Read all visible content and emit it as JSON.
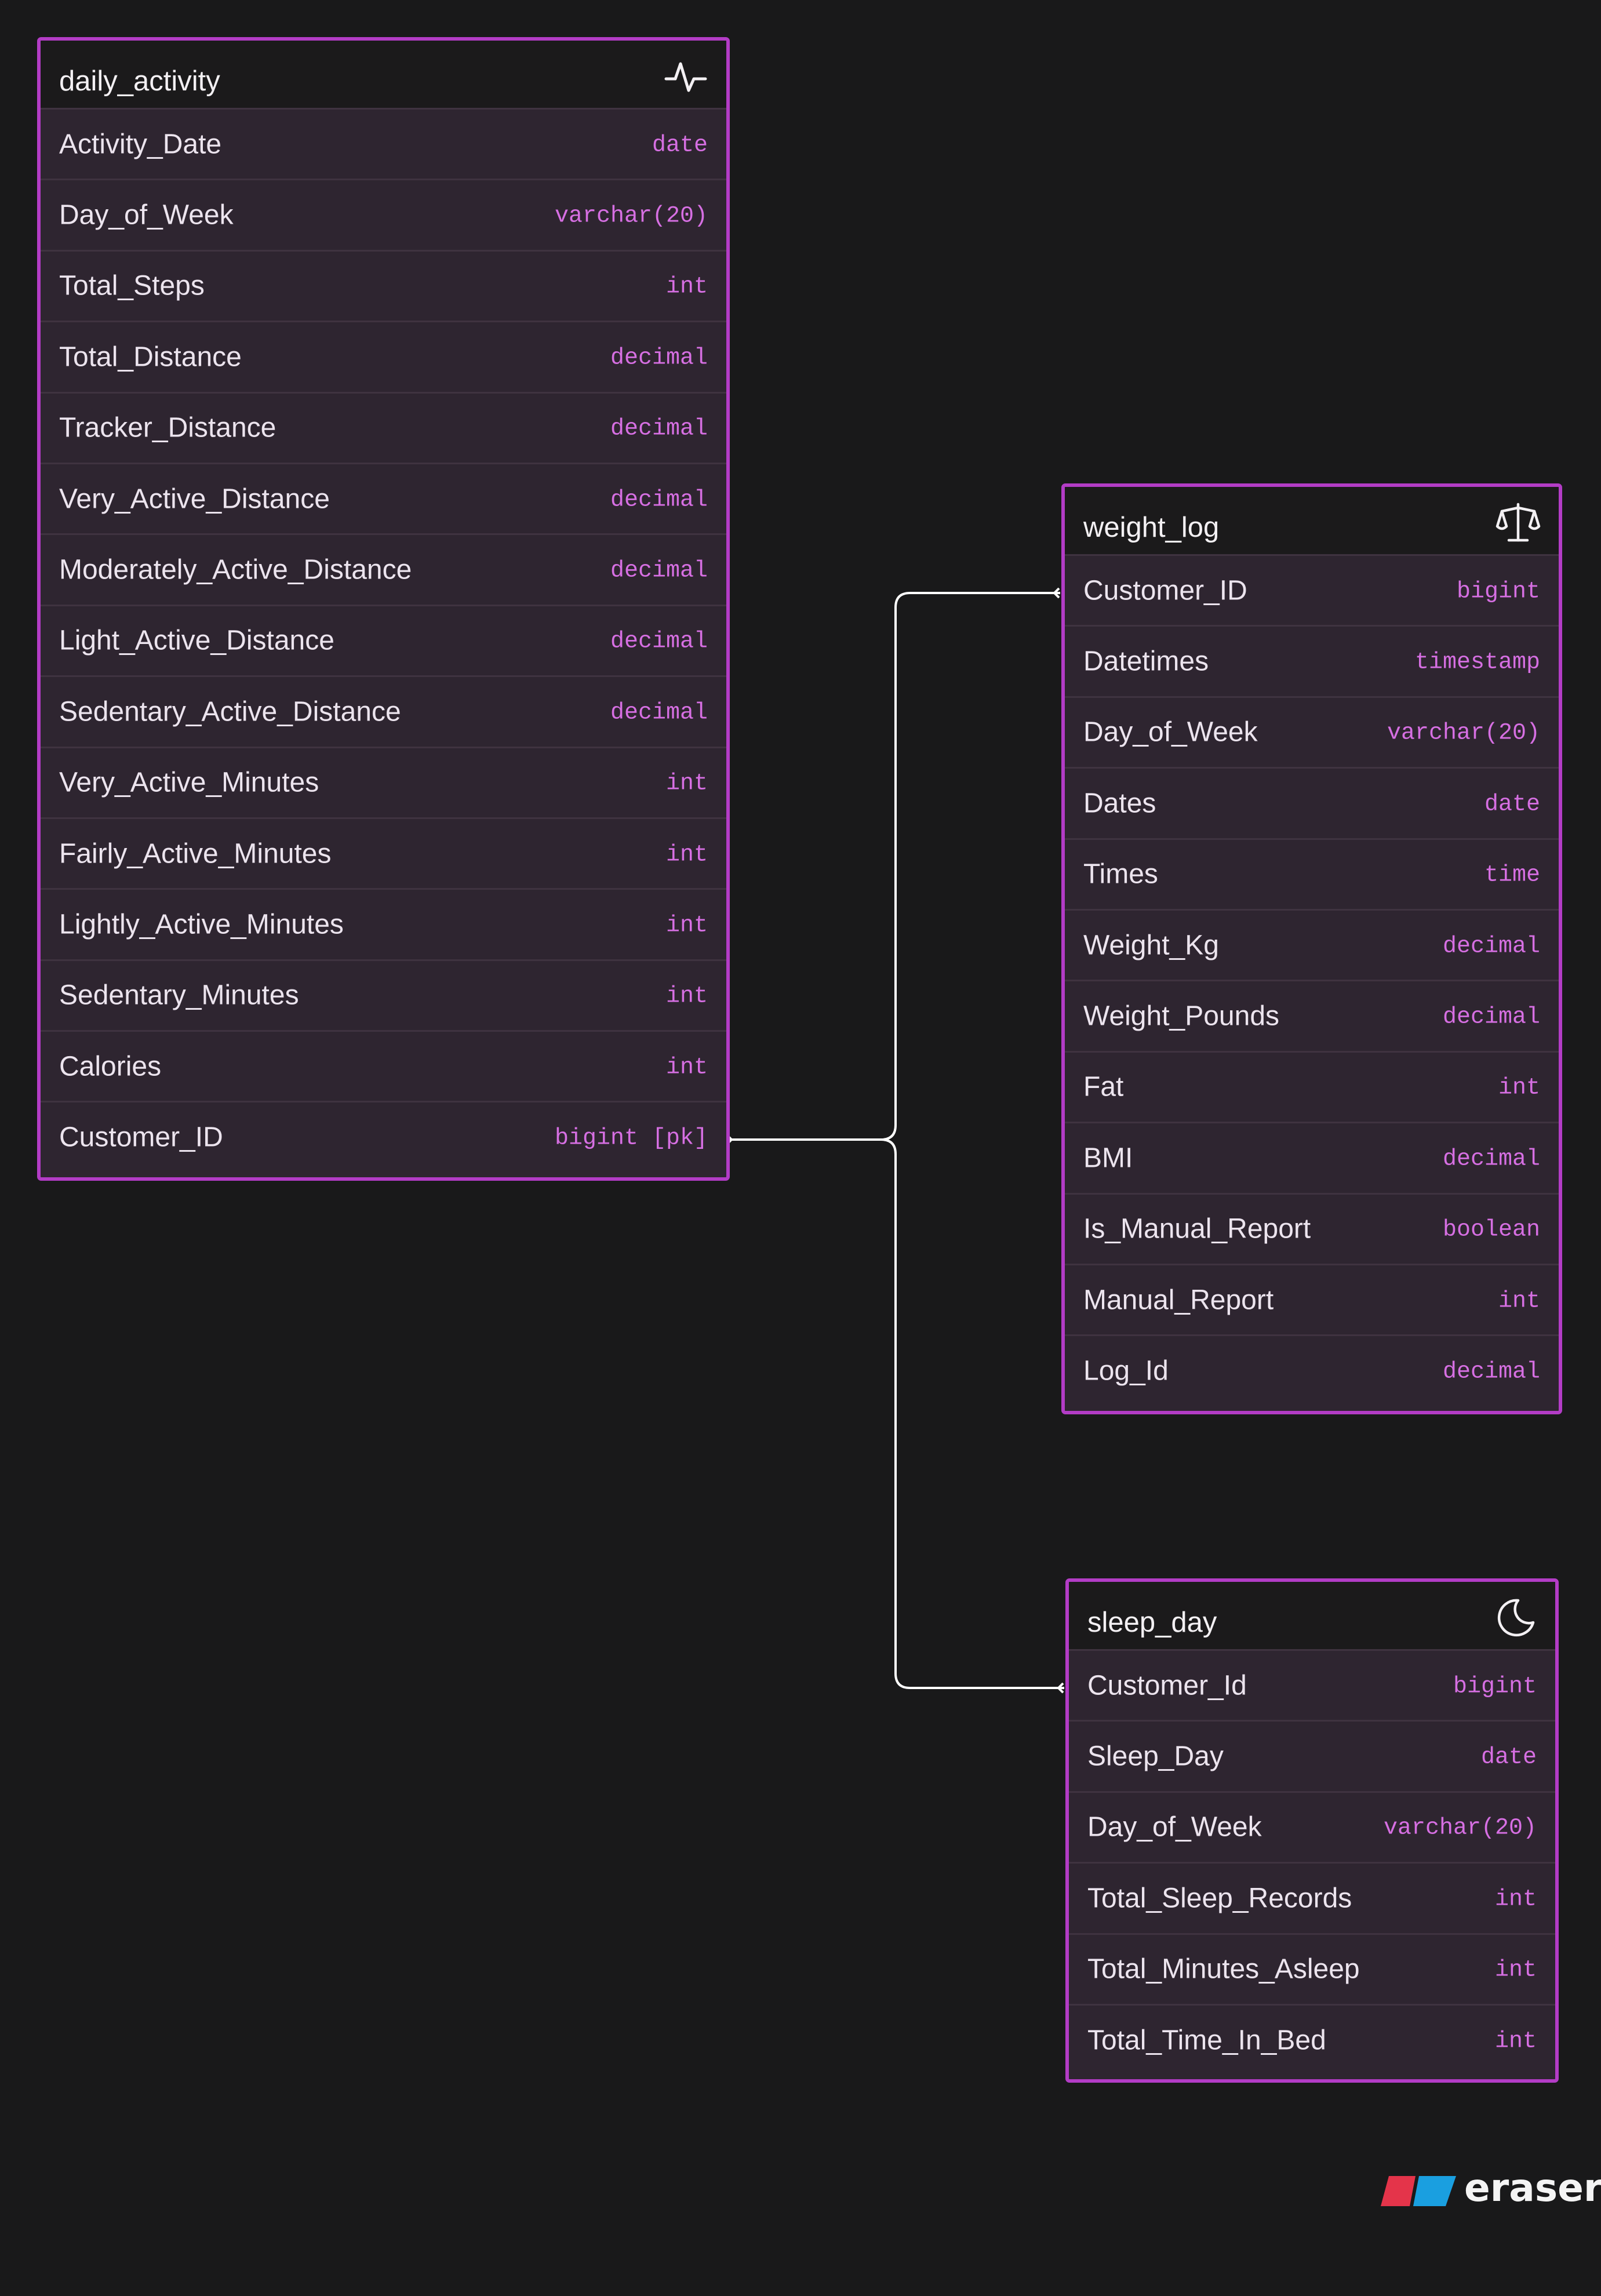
{
  "tables": [
    {
      "id": "daily_activity",
      "name": "daily_activity",
      "icon": "activity-pulse-icon",
      "fields": [
        {
          "name": "Activity_Date",
          "type": "date"
        },
        {
          "name": "Day_of_Week",
          "type": "varchar(20)"
        },
        {
          "name": "Total_Steps",
          "type": "int"
        },
        {
          "name": "Total_Distance",
          "type": "decimal"
        },
        {
          "name": "Tracker_Distance",
          "type": "decimal"
        },
        {
          "name": "Very_Active_Distance",
          "type": "decimal"
        },
        {
          "name": "Moderately_Active_Distance",
          "type": "decimal"
        },
        {
          "name": "Light_Active_Distance",
          "type": "decimal"
        },
        {
          "name": "Sedentary_Active_Distance",
          "type": "decimal"
        },
        {
          "name": "Very_Active_Minutes",
          "type": "int"
        },
        {
          "name": "Fairly_Active_Minutes",
          "type": "int"
        },
        {
          "name": "Lightly_Active_Minutes",
          "type": "int"
        },
        {
          "name": "Sedentary_Minutes",
          "type": "int"
        },
        {
          "name": "Calories",
          "type": "int"
        },
        {
          "name": "Customer_ID",
          "type": "bigint [pk]"
        }
      ]
    },
    {
      "id": "weight_log",
      "name": "weight_log",
      "icon": "scale-icon",
      "fields": [
        {
          "name": "Customer_ID",
          "type": "bigint"
        },
        {
          "name": "Datetimes",
          "type": "timestamp"
        },
        {
          "name": "Day_of_Week",
          "type": "varchar(20)"
        },
        {
          "name": "Dates",
          "type": "date"
        },
        {
          "name": "Times",
          "type": "time"
        },
        {
          "name": "Weight_Kg",
          "type": "decimal"
        },
        {
          "name": "Weight_Pounds",
          "type": "decimal"
        },
        {
          "name": "Fat",
          "type": "int"
        },
        {
          "name": "BMI",
          "type": "decimal"
        },
        {
          "name": "Is_Manual_Report",
          "type": "boolean"
        },
        {
          "name": "Manual_Report",
          "type": "int"
        },
        {
          "name": "Log_Id",
          "type": "decimal"
        }
      ]
    },
    {
      "id": "sleep_day",
      "name": "sleep_day",
      "icon": "moon-icon",
      "fields": [
        {
          "name": "Customer_Id",
          "type": "bigint"
        },
        {
          "name": "Sleep_Day",
          "type": "date"
        },
        {
          "name": "Day_of_Week",
          "type": "varchar(20)"
        },
        {
          "name": "Total_Sleep_Records",
          "type": "int"
        },
        {
          "name": "Total_Minutes_Asleep",
          "type": "int"
        },
        {
          "name": "Total_Time_In_Bed",
          "type": "int"
        }
      ]
    }
  ],
  "relationships": [
    {
      "from": "daily_activity.Customer_ID",
      "to": "weight_log.Customer_ID"
    },
    {
      "from": "daily_activity.Customer_ID",
      "to": "sleep_day.Customer_Id"
    }
  ],
  "brand": {
    "text": "eraser",
    "colors": {
      "left": "#e4344a",
      "right": "#1a9fe0"
    }
  },
  "colors": {
    "background": "#19191a",
    "table_border": "#b33cc6",
    "type_text": "#d66fe2",
    "connector": "#ffffff"
  }
}
